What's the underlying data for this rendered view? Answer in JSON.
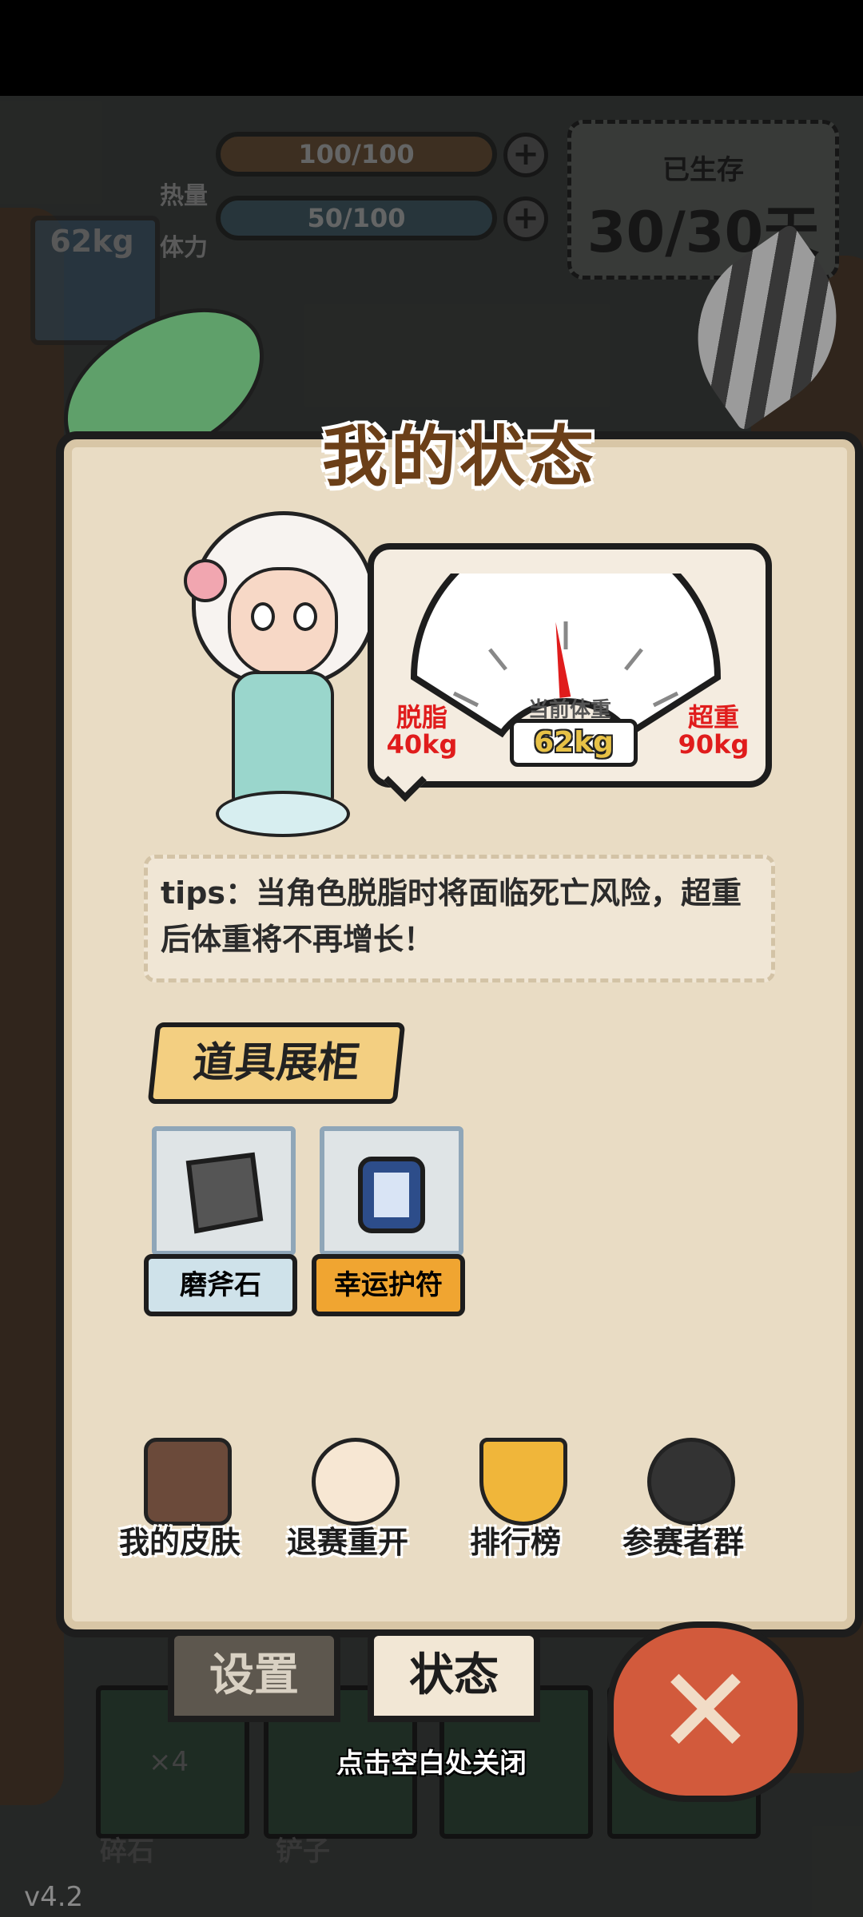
{
  "hud": {
    "avatar_icon": "shiba-dog-avatar",
    "weight": "62kg",
    "calories_label": "热量",
    "calories_value": "100/100",
    "stamina_label": "体力",
    "stamina_value": "50/100",
    "survive_label": "已生存",
    "survive_value": "30/30天"
  },
  "panel": {
    "title": "我的状态",
    "scale": {
      "min_label": "脱脂",
      "min_value": "40kg",
      "current_label": "当前体重",
      "current_value": "62kg",
      "max_label": "超重",
      "max_value": "90kg",
      "needle_fraction": 0.44
    },
    "tips": "tips：当角色脱脂时将面临死亡风险，超重后体重将不再增长！",
    "section_title": "道具展柜",
    "items": [
      {
        "label": "磨斧石",
        "icon": "whetstone-icon",
        "color": "#cfe2ea"
      },
      {
        "label": "幸运护符",
        "icon": "lucky-charm-icon",
        "color": "#f0a531"
      }
    ],
    "actions": [
      {
        "label": "我的皮肤",
        "icon": "skin-hanger-icon"
      },
      {
        "label": "退赛重开",
        "icon": "restart-character-icon"
      },
      {
        "label": "排行榜",
        "icon": "trophy-icon"
      },
      {
        "label": "参赛者群",
        "icon": "penguin-group-icon"
      }
    ]
  },
  "tabs": {
    "settings": "设置",
    "status": "状态"
  },
  "close_hint": "点击空白处关闭",
  "inventory": {
    "count": "×4",
    "slot1_label": "碎石",
    "slot2_label": "铲子"
  },
  "version": "v4.2",
  "colors": {
    "panel_bg": "#e9dcc4",
    "title_brown": "#6b3f18",
    "danger_red": "#e01c1c",
    "accent_orange": "#f0a531",
    "close_red": "#d25a3c"
  }
}
